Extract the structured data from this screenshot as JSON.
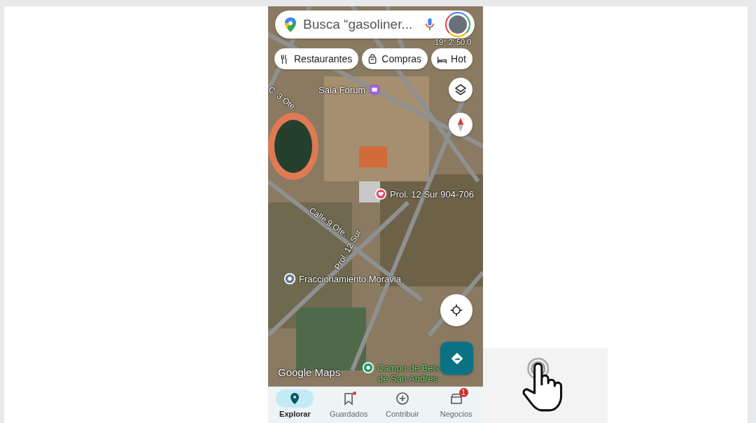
{
  "search": {
    "placeholder": "Busca “gasoliner..."
  },
  "chips": [
    {
      "label": "Restaurantes",
      "kind": "food"
    },
    {
      "label": "Compras",
      "kind": "shopping"
    },
    {
      "label": "Hot",
      "kind": "hotel"
    }
  ],
  "map_labels": [
    {
      "text": "19° 2' 50.0",
      "kind": "coords"
    },
    {
      "text": "Sala Forum",
      "kind": "place"
    },
    {
      "text": "C. 3 Ote.",
      "kind": "street"
    },
    {
      "text": "Prol. 12 Sur 904-706",
      "kind": "saved"
    },
    {
      "text": "Calle 9 Ote.",
      "kind": "street"
    },
    {
      "text": "Prol. 12 Sur",
      "kind": "street"
    },
    {
      "text": "Fraccionamiento Moravia",
      "kind": "area"
    },
    {
      "text": "Campo de Beis",
      "kind": "park"
    },
    {
      "text": "de San Andres",
      "kind": "park"
    },
    {
      "text": "Google Maps",
      "kind": "brand"
    }
  ],
  "nav": [
    {
      "label": "Explorar",
      "selected": true,
      "kind": "explore",
      "dot": false
    },
    {
      "label": "Guardados",
      "selected": false,
      "kind": "saved",
      "dot": true
    },
    {
      "label": "Contribuir",
      "selected": false,
      "kind": "contribute",
      "dot": false
    },
    {
      "label": "Negocios",
      "selected": false,
      "kind": "business",
      "dot": false,
      "badge": "1"
    }
  ]
}
